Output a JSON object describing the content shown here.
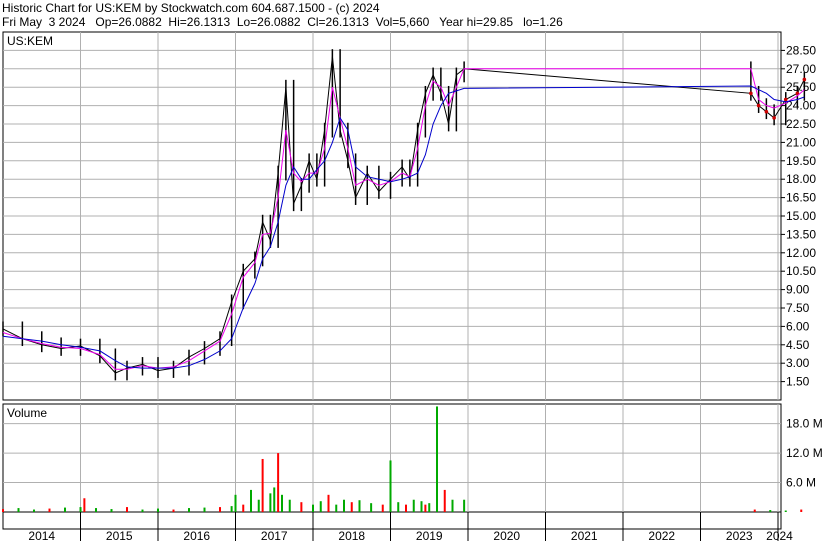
{
  "header": {
    "title": "Historic Chart for US:KEM by Stockwatch.com 604.687.1500 - (c) 2024",
    "info": "Fri May  3 2024   Op=26.0882  Hi=26.1313  Lo=26.0882  Cl=26.1313  Vol=5,660   Year hi=29.85   lo=1.26"
  },
  "chart_data": [
    {
      "type": "line",
      "title": "US:KEM",
      "subtype": "price (daily bars with moving averages)",
      "ylim": [
        0,
        30
      ],
      "yticks": [
        1.5,
        3.0,
        4.5,
        6.0,
        7.5,
        9.0,
        10.5,
        12.0,
        13.5,
        15.0,
        16.5,
        18.0,
        19.5,
        21.0,
        22.5,
        24.0,
        25.5,
        27.0,
        28.5
      ],
      "ytick_labels": [
        "1.50",
        "3.00",
        "4.50",
        "6.00",
        "7.50",
        "9.00",
        "10.50",
        "12.00",
        "13.50",
        "15.00",
        "16.50",
        "18.00",
        "19.50",
        "21.00",
        "22.50",
        "24.00",
        "25.50",
        "27.00",
        "28.50"
      ],
      "x": [
        2014.0,
        2014.25,
        2014.5,
        2014.75,
        2015.0,
        2015.25,
        2015.45,
        2015.6,
        2015.8,
        2016.0,
        2016.2,
        2016.4,
        2016.6,
        2016.8,
        2016.95,
        2017.1,
        2017.25,
        2017.35,
        2017.45,
        2017.55,
        2017.65,
        2017.75,
        2017.85,
        2017.95,
        2018.05,
        2018.15,
        2018.25,
        2018.35,
        2018.45,
        2018.55,
        2018.7,
        2018.85,
        2019.0,
        2019.15,
        2019.25,
        2019.35,
        2019.45,
        2019.55,
        2019.65,
        2019.75,
        2019.85,
        2019.95,
        2023.65,
        2023.75,
        2023.85,
        2023.95,
        2024.1,
        2024.25,
        2024.34
      ],
      "series": [
        {
          "values": [
            5.8,
            5.0,
            4.5,
            4.2,
            4.4,
            3.6,
            2.2,
            2.6,
            2.9,
            2.4,
            2.6,
            3.5,
            4.2,
            5.0,
            8.0,
            10.5,
            11.5,
            14.5,
            13.0,
            18.5,
            25.5,
            16.0,
            17.5,
            19.5,
            18.0,
            22.0,
            28.0,
            22.0,
            19.5,
            16.5,
            18.5,
            17.0,
            18.0,
            19.0,
            18.0,
            22.0,
            25.0,
            26.5,
            25.0,
            22.5,
            26.5,
            27.0,
            25.0,
            24.0,
            23.5,
            23.0,
            24.5,
            25.0,
            26.1313
          ]
        },
        {
          "color": "#ee00ee",
          "values": [
            5.5,
            5.0,
            4.6,
            4.3,
            4.2,
            3.7,
            2.5,
            2.5,
            2.8,
            2.6,
            2.7,
            3.2,
            4.0,
            4.8,
            7.0,
            10.0,
            11.2,
            13.5,
            13.6,
            16.5,
            22.0,
            18.5,
            17.8,
            18.5,
            18.5,
            20.5,
            25.5,
            23.0,
            20.5,
            17.5,
            18.0,
            17.5,
            17.8,
            18.5,
            18.2,
            20.5,
            24.0,
            26.0,
            25.5,
            24.0,
            25.5,
            27.0,
            27.0,
            24.5,
            24.0,
            23.8,
            24.2,
            24.8,
            25.3
          ]
        },
        {
          "color": "#0000cc",
          "values": [
            5.2,
            5.0,
            4.8,
            4.5,
            4.3,
            4.0,
            3.2,
            2.7,
            2.6,
            2.6,
            2.6,
            2.8,
            3.3,
            4.0,
            5.0,
            7.5,
            9.5,
            11.5,
            12.5,
            14.5,
            17.5,
            19.0,
            18.0,
            18.0,
            18.8,
            19.5,
            21.0,
            23.0,
            22.0,
            19.0,
            18.2,
            18.0,
            17.8,
            18.0,
            18.2,
            18.5,
            20.0,
            22.5,
            24.0,
            25.0,
            25.2,
            25.4,
            25.6,
            25.3,
            25.0,
            24.5,
            24.3,
            24.5,
            24.7
          ]
        }
      ]
    },
    {
      "type": "bar",
      "title": "Volume",
      "unit": "M",
      "ylim": [
        0,
        22
      ],
      "yticks": [
        6.0,
        12.0,
        18.0
      ],
      "ytick_labels": [
        "6.0 M",
        "12.0 M",
        "18.0 M"
      ],
      "x": [
        2014.0,
        2014.2,
        2014.4,
        2014.6,
        2014.8,
        2015.0,
        2015.05,
        2015.2,
        2015.4,
        2015.6,
        2015.8,
        2016.0,
        2016.2,
        2016.4,
        2016.6,
        2016.8,
        2016.95,
        2017.0,
        2017.1,
        2017.2,
        2017.3,
        2017.35,
        2017.45,
        2017.5,
        2017.55,
        2017.6,
        2017.7,
        2017.85,
        2018.0,
        2018.1,
        2018.2,
        2018.3,
        2018.4,
        2018.5,
        2018.6,
        2018.75,
        2018.9,
        2019.0,
        2019.1,
        2019.2,
        2019.3,
        2019.4,
        2019.45,
        2019.5,
        2019.6,
        2019.7,
        2019.8,
        2019.95,
        2023.7,
        2023.9,
        2024.1,
        2024.3
      ],
      "values": [
        0.6,
        0.8,
        0.5,
        0.7,
        0.9,
        1.0,
        2.8,
        0.8,
        0.6,
        1.0,
        0.5,
        0.7,
        0.5,
        0.8,
        0.9,
        1.0,
        1.2,
        3.5,
        1.5,
        4.5,
        2.5,
        10.8,
        3.8,
        5.0,
        12.0,
        3.5,
        2.5,
        2.0,
        1.5,
        2.2,
        3.5,
        1.5,
        2.5,
        2.0,
        2.4,
        1.8,
        1.5,
        10.5,
        2.0,
        1.5,
        2.5,
        2.2,
        1.5,
        1.8,
        21.5,
        4.5,
        2.5,
        2.5,
        0.5,
        0.4,
        0.3,
        0.5
      ]
    }
  ],
  "price_panel": {
    "label": "US:KEM"
  },
  "volume_panel": {
    "label": "Volume"
  },
  "x_axis": {
    "labels": [
      "2014",
      "2015",
      "2016",
      "2017",
      "2018",
      "2019",
      "2020",
      "2021",
      "2022",
      "2023",
      "2024"
    ]
  }
}
